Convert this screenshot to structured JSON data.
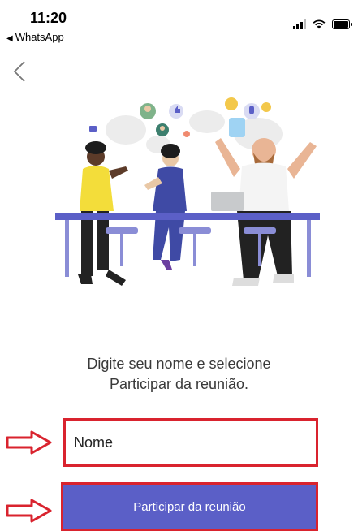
{
  "status_bar": {
    "time": "11:20",
    "back_app": "WhatsApp"
  },
  "navigation": {
    "back_icon": "chevron-left-icon"
  },
  "illustration": {
    "description_icon": "meeting-people-illustration"
  },
  "instruction": {
    "line1": "Digite seu nome e selecione",
    "line2": "Participar da reunião."
  },
  "name_input": {
    "placeholder": "Nome",
    "value": ""
  },
  "join_button": {
    "label": "Participar da reunião"
  },
  "colors": {
    "accent": "#5b5fc7",
    "highlight": "#d9232e"
  }
}
